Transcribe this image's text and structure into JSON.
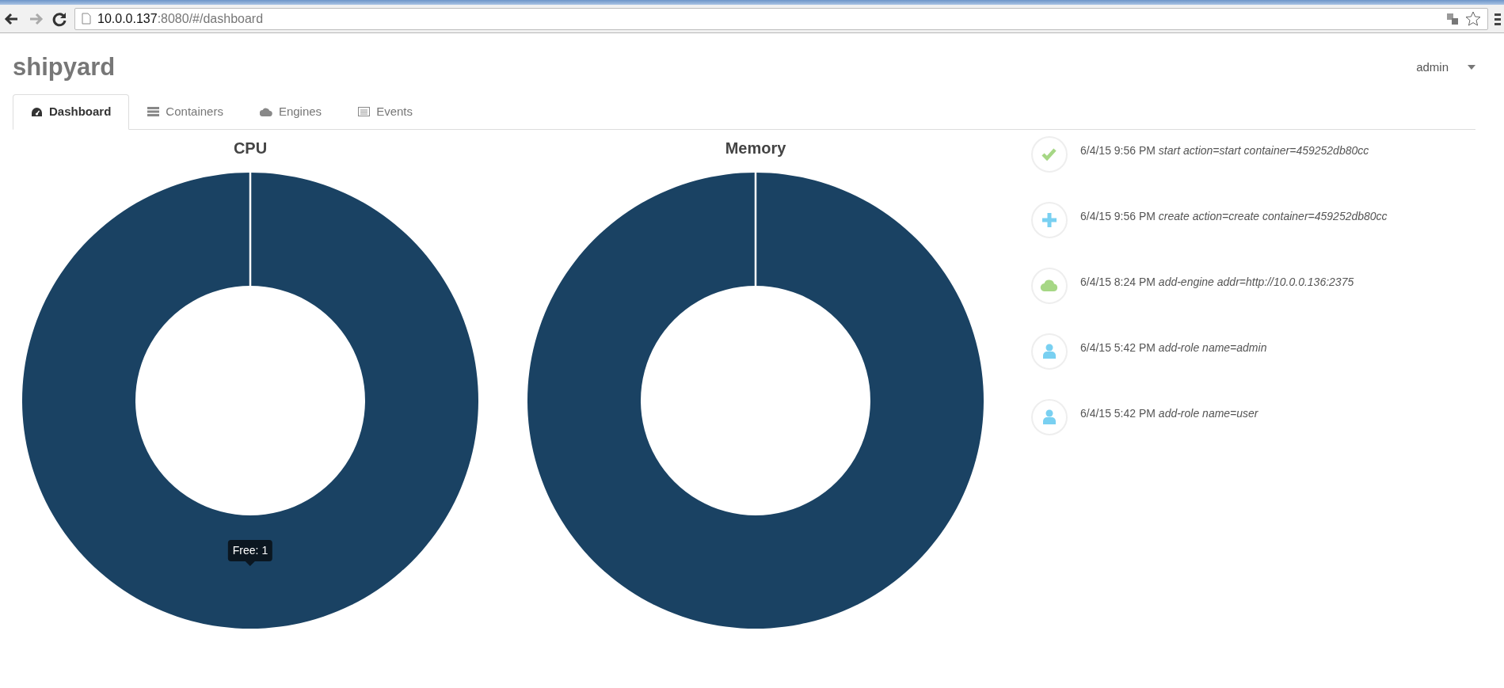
{
  "browser": {
    "url_host": "10.0.0.137",
    "url_rest": ":8080/#/dashboard"
  },
  "brand": "shipyard",
  "user_menu": {
    "label": "admin"
  },
  "tabs": [
    {
      "label": "Dashboard",
      "kind": "dashboard",
      "selected": true
    },
    {
      "label": "Containers",
      "kind": "containers",
      "selected": false
    },
    {
      "label": "Engines",
      "kind": "engines",
      "selected": false
    },
    {
      "label": "Events",
      "kind": "events",
      "selected": false
    }
  ],
  "charts": [
    {
      "title": "CPU",
      "tooltip": "Free: 1"
    },
    {
      "title": "Memory"
    }
  ],
  "events": [
    {
      "kind": "start",
      "time": "6/4/15 9:56 PM",
      "message": "start action=start container=459252db80cc"
    },
    {
      "kind": "create",
      "time": "6/4/15 9:56 PM",
      "message": "create action=create container=459252db80cc"
    },
    {
      "kind": "engine",
      "time": "6/4/15 8:24 PM",
      "message": "add-engine addr=http://10.0.0.136:2375"
    },
    {
      "kind": "role",
      "time": "6/4/15 5:42 PM",
      "message": "add-role name=admin"
    },
    {
      "kind": "role",
      "time": "6/4/15 5:42 PM",
      "message": "add-role name=user"
    }
  ]
}
